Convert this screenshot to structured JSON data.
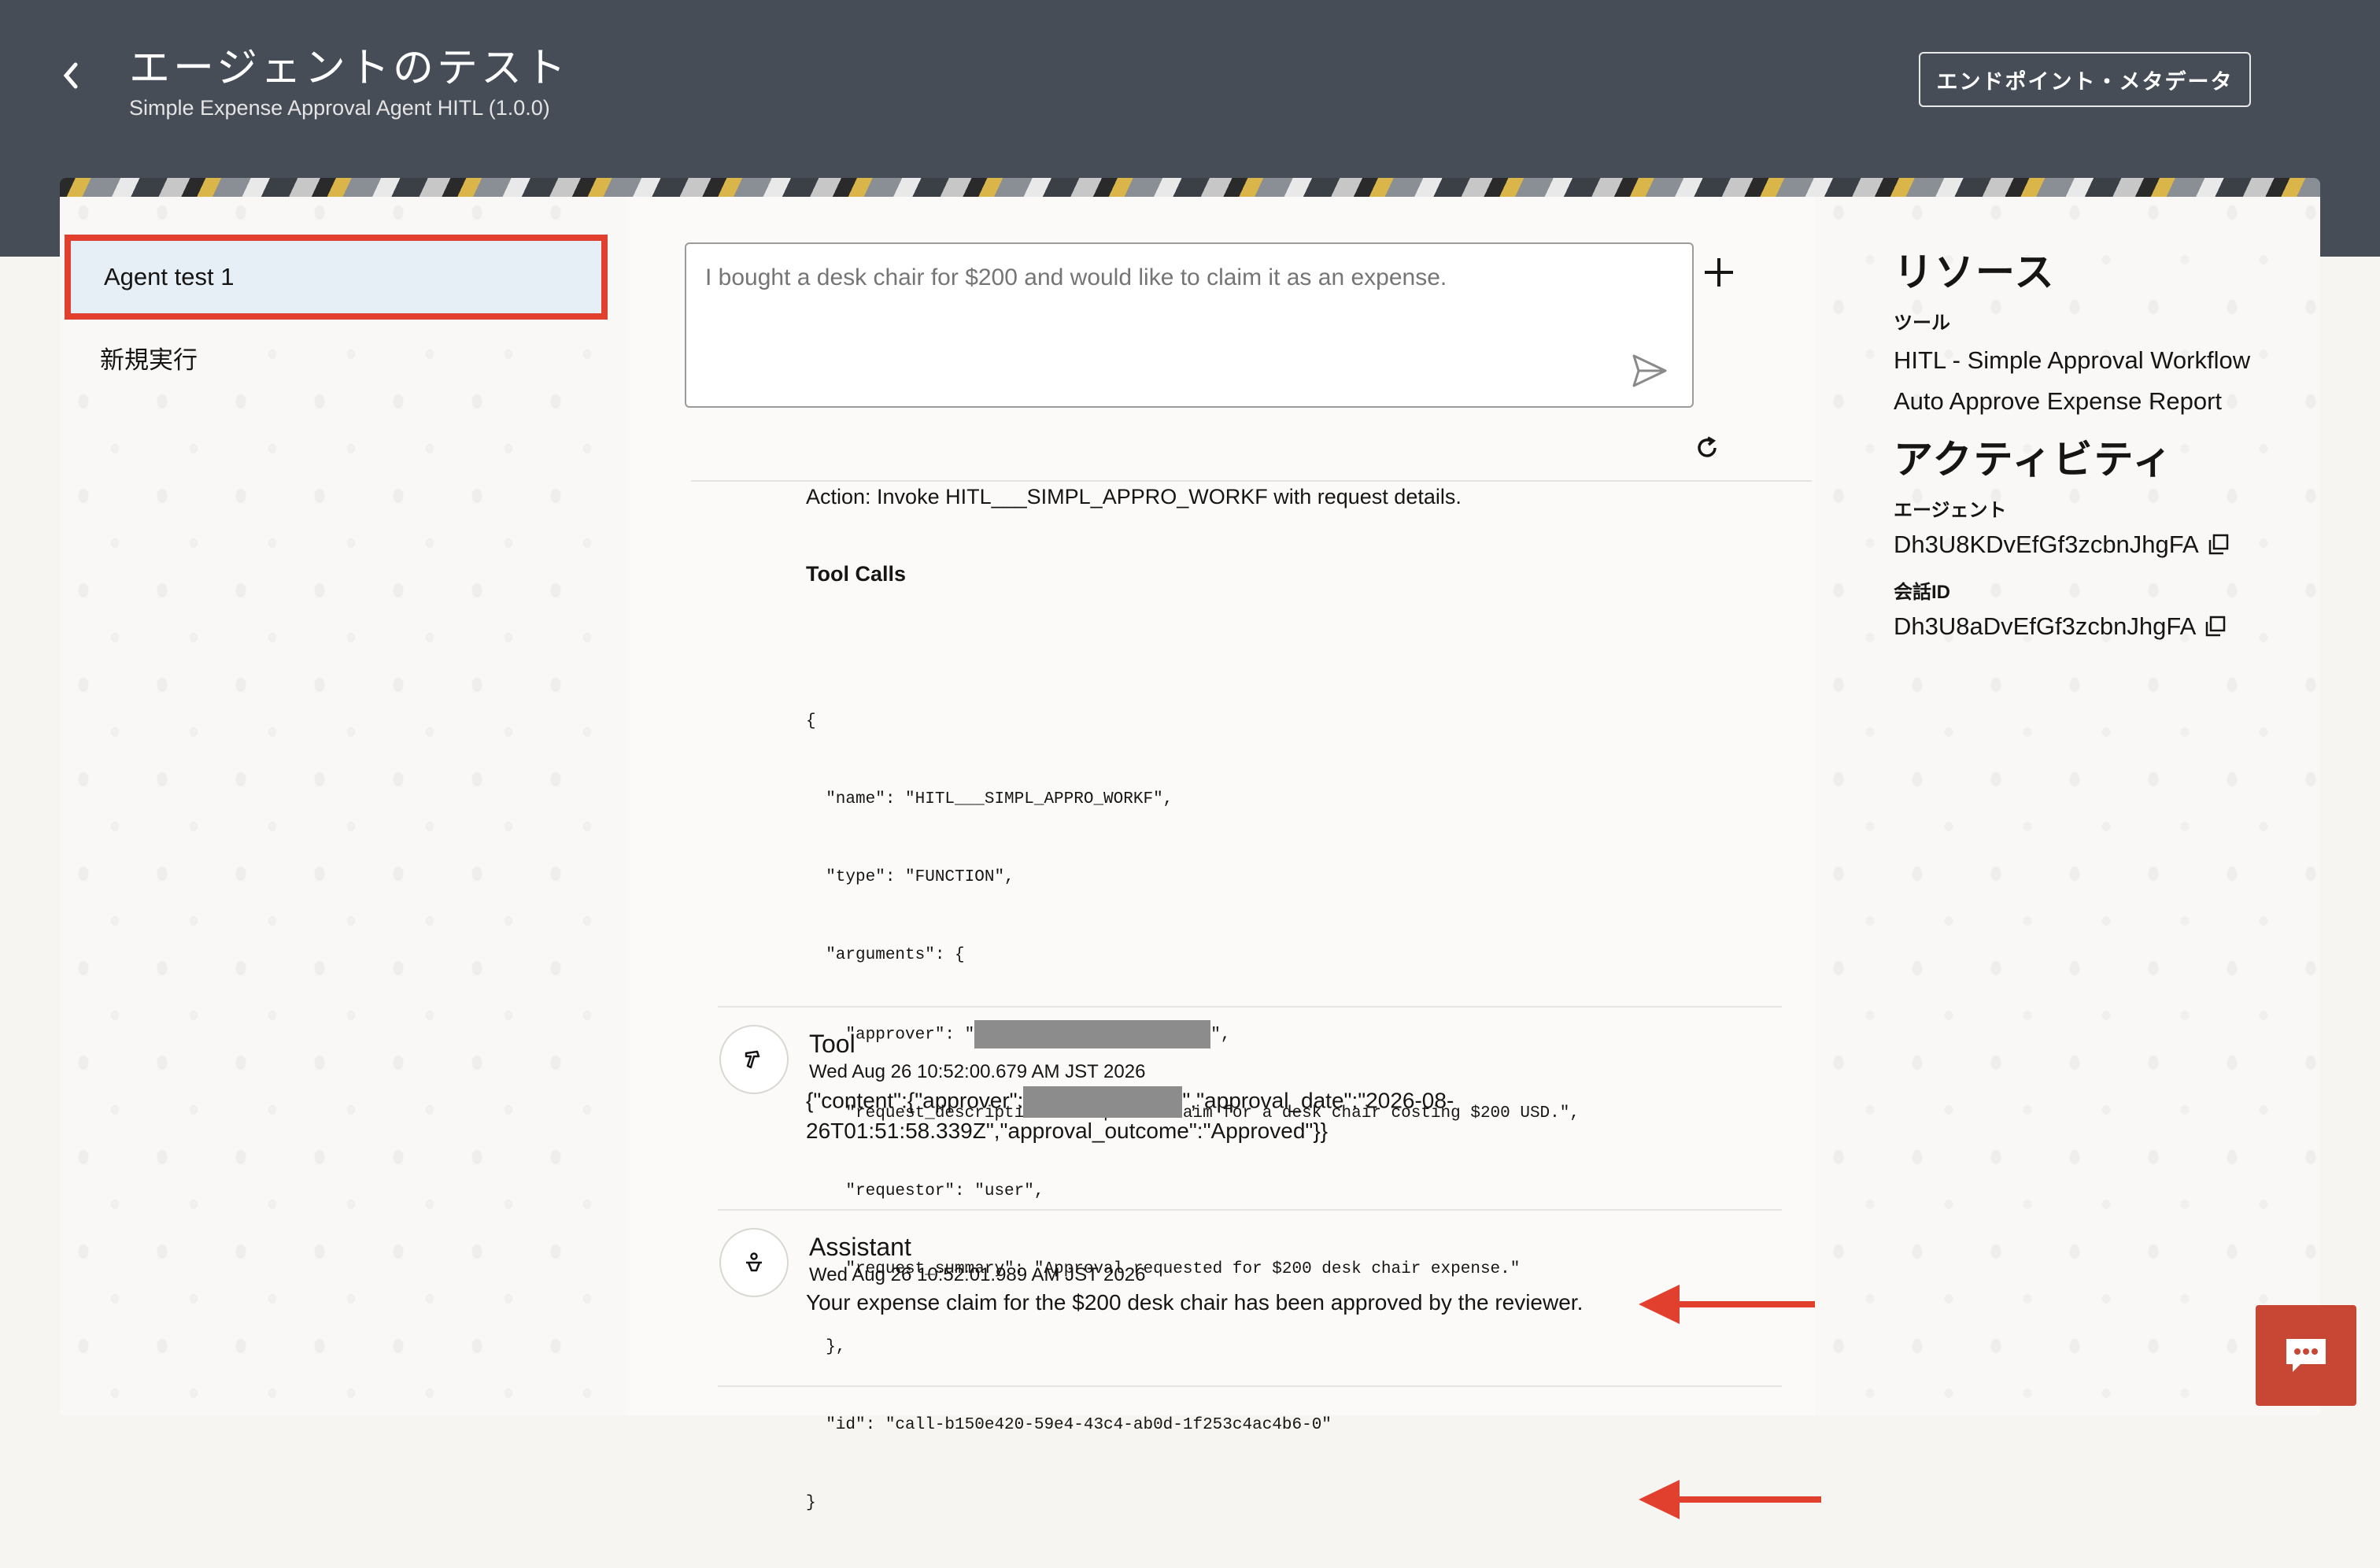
{
  "header": {
    "title": "エージェントのテスト",
    "subtitle": "Simple Expense Approval Agent HITL (1.0.0)",
    "endpoint_button": "エンドポイント・メタデータ"
  },
  "runs": {
    "active": "Agent test 1",
    "new": "新規実行"
  },
  "prompt": {
    "placeholder": "I bought a desk chair for $200 and would like to claim it as an expense."
  },
  "trace": {
    "action": "Action: Invoke HITL___SIMPL_APPRO_WORKF with request details.",
    "tool_calls_label": "Tool Calls",
    "json": {
      "l1": "{",
      "l2": "  \"name\": \"HITL___SIMPL_APPRO_WORKF\",",
      "l3": "  \"type\": \"FUNCTION\",",
      "l4": "  \"arguments\": {",
      "l5a": "    \"approver\": \"",
      "l5b": "\",",
      "l6": "    \"request_description\": \"Expense claim for a desk chair costing $200 USD.\",",
      "l7": "    \"requestor\": \"user\",",
      "l8": "    \"request_summary\": \"Approval requested for $200 desk chair expense.\"",
      "l9": "  },",
      "l10": "  \"id\": \"call-b150e420-59e4-43c4-ab0d-1f253c4ac4b6-0\"",
      "l11": "}"
    }
  },
  "messages": [
    {
      "role": "Tool",
      "time": "Wed Aug 26 10:52:00.679 AM JST 2026",
      "body_a": "{\"content\":{\"approver\":",
      "body_b": "\",\"approval_date\":\"2026-08-",
      "body_c": "26T01:51:58.339Z\",\"approval_outcome\":\"Approved\"}}"
    },
    {
      "role": "Assistant",
      "time": "Wed Aug 26 10:52:01.989 AM JST 2026",
      "body": "Your expense claim for the $200 desk chair has been approved by the reviewer."
    }
  ],
  "resources": {
    "heading": "リソース",
    "tools_label": "ツール",
    "tools": [
      "HITL - Simple Approval Workflow",
      "Auto Approve Expense Report"
    ],
    "activity_heading": "アクティビティ",
    "agent_label": "エージェント",
    "agent_id": "Dh3U8KDvEfGf3zcbnJhgFA",
    "session_label": "会話ID",
    "session_id": "Dh3U8aDvEfGf3zcbnJhgFA"
  },
  "colors": {
    "accent": "#c74634",
    "highlight_border": "#e0402d",
    "arrow": "#e0402d",
    "header_bg": "#474d57"
  }
}
